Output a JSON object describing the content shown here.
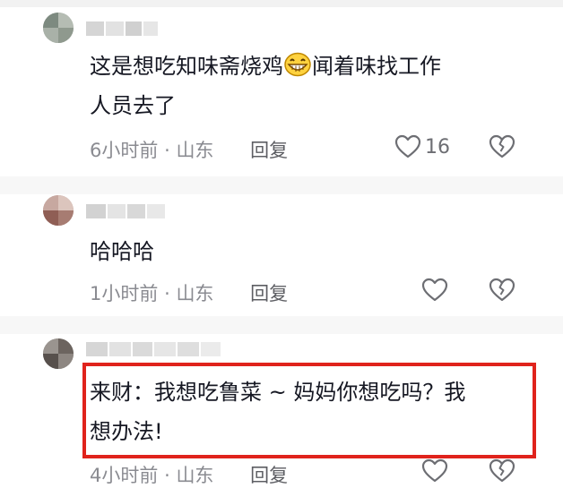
{
  "comments": [
    {
      "text_line1": "这是想吃知味斋烧鸡",
      "text_line1b": "闻着味找工作",
      "text_line2": "人员去了",
      "time": "6小时前",
      "sep": "·",
      "location": "山东",
      "reply": "回复",
      "likes": "16"
    },
    {
      "text_line1": "哈哈哈",
      "time": "1小时前",
      "sep": "·",
      "location": "山东",
      "reply": "回复"
    },
    {
      "text_line1": "来财：我想吃鲁菜 ~ 妈妈你想吃吗？我",
      "text_line2": "想办法!",
      "time": "4小时前",
      "sep": "·",
      "location": "山东",
      "reply": "回复"
    }
  ],
  "colors": {
    "highlight": "#e0231c",
    "meta": "#8a8b91"
  },
  "icons": [
    "grin-emoji-icon",
    "heart-icon",
    "broken-heart-icon"
  ]
}
